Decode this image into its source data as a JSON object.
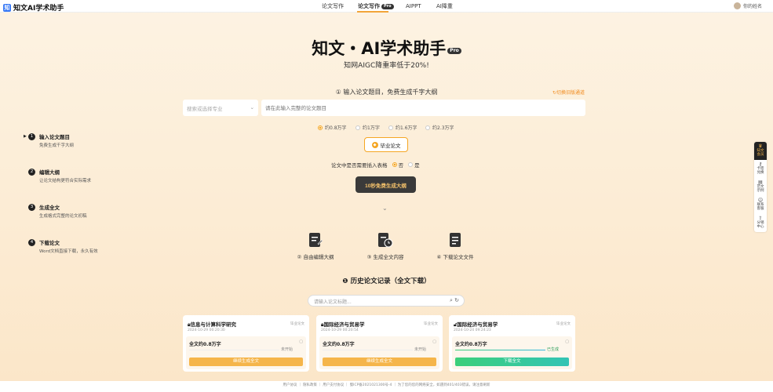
{
  "header": {
    "logo_mark": "知",
    "logo": "知文AI学术助手",
    "nav": [
      "论文写作",
      "论文写作",
      "AIPPT",
      "AI降重"
    ],
    "pro_badge": "Pro",
    "user_name": "你的姓名"
  },
  "hero": {
    "title": "知文・AI学术助手",
    "pro": "Pro",
    "subtitle": "知网AIGC降重率低于20%!"
  },
  "form": {
    "step_tip": "① 输入论文题目，免费生成千字大纲",
    "switch_link": "↻切换旧版通道",
    "major_placeholder": "搜索或选择专业",
    "title_placeholder": "请在此输入完整的论文题目",
    "word_options": [
      {
        "label": "约0.8万字",
        "selected": true
      },
      {
        "label": "约1万字",
        "selected": false
      },
      {
        "label": "约1.6万字",
        "selected": false
      },
      {
        "label": "约2.3万字",
        "selected": false
      }
    ],
    "paper_type": "毕业论文",
    "table_question": "论文中是否需要插入表格",
    "table_options": [
      {
        "label": "否",
        "selected": true
      },
      {
        "label": "是",
        "selected": false
      }
    ],
    "generate_button": "10秒免费生成大纲"
  },
  "left_steps": [
    {
      "num": "1",
      "title": "输入论文题目",
      "desc": "免费生成千字大纲"
    },
    {
      "num": "2",
      "title": "编辑大纲",
      "desc": "让论文结构更符合实际需求"
    },
    {
      "num": "3",
      "title": "生成全文",
      "desc": "生成格式完整的论文初稿"
    },
    {
      "num": "4",
      "title": "下载论文",
      "desc": "Word文档直接下载，永久有效"
    }
  ],
  "features": [
    "② 自由编辑大纲",
    "③ 生成全文内容",
    "④ 下载论文文件"
  ],
  "history": {
    "title": "历史论文记录（全文下载）",
    "search_placeholder": "请输入论文标题...",
    "cards": [
      {
        "title": "信息与计算科学研究",
        "tag": "毕业论文",
        "time": "2024-10-29 00:20:30",
        "words": "全文约0.8万字",
        "status": "未开始",
        "action": "继续生成全文",
        "done": false
      },
      {
        "title": "国际经济与贸易学",
        "tag": "毕业论文",
        "time": "2024-10-29 00:20:54",
        "words": "全文约0.8万字",
        "status": "未开始",
        "action": "继续生成全文",
        "done": false
      },
      {
        "title": "国际经济与贸易学",
        "tag": "毕业论文",
        "time": "2024-10-24 09:24:23",
        "words": "全文约0.8万字",
        "status": "已生成",
        "action": "下载全文",
        "done": true
      }
    ]
  },
  "footer": "用户协议 ｜ 隐私政策 ｜ 用户支付协议 ｜ 蜀ICP备2021021300号-4 ｜ 为了您的您的网络安全，如遇到401/403错误，请注意刷新",
  "right_sidebar": [
    {
      "label": "知文\n会员",
      "icon": "crown-icon"
    },
    {
      "label": "卡密\n兑换",
      "icon": "key-icon"
    },
    {
      "label": "范文\n示例",
      "icon": "doc-icon"
    },
    {
      "label": "联系\n客服",
      "icon": "chat-icon"
    },
    {
      "label": "分销\n中心",
      "icon": "share-icon"
    }
  ],
  "colors": {
    "accent": "#f5a623",
    "dark_button": "#3a3a3a",
    "download": "#3ccf7a"
  }
}
